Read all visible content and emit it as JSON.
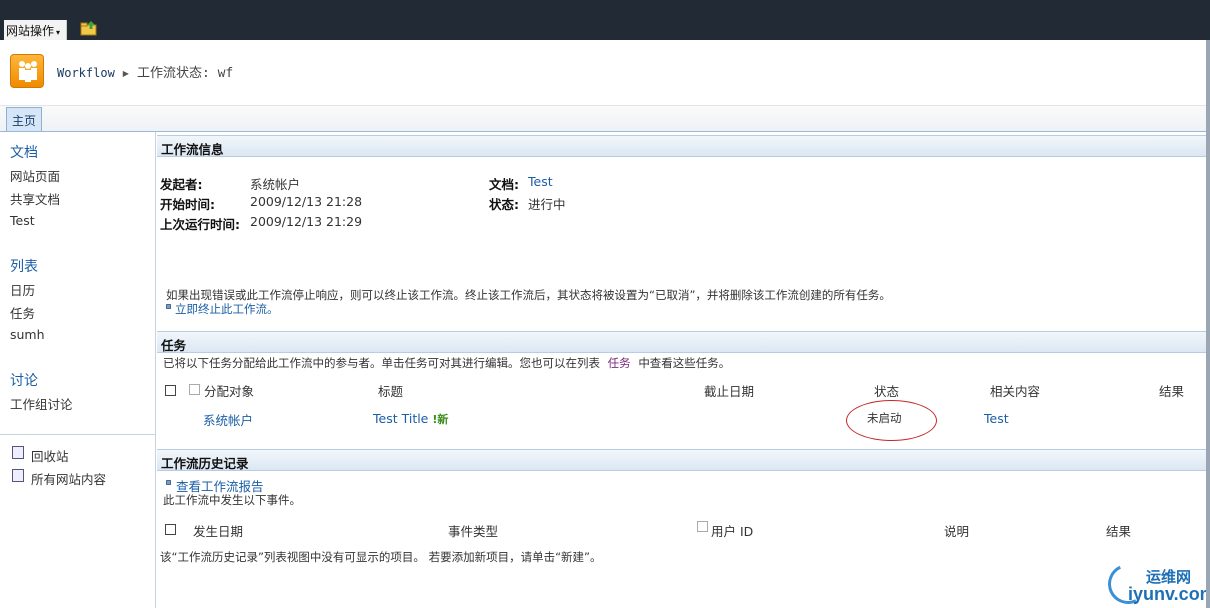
{
  "topbar": {
    "site_actions": "网站操作",
    "caret": "▾"
  },
  "header": {
    "site": "Workflow",
    "page_title": "工作流状态: wf"
  },
  "tabs": {
    "home": "主页"
  },
  "leftnav": {
    "docs_head": "文档",
    "docs": [
      "网站页面",
      "共享文档",
      "Test"
    ],
    "lists_head": "列表",
    "lists": [
      "日历",
      "任务",
      "sumh"
    ],
    "disc_head": "讨论",
    "disc": [
      "工作组讨论"
    ],
    "recycle": "回收站",
    "all_content": "所有网站内容"
  },
  "info": {
    "title": "工作流信息",
    "initiator_label": "发起者:",
    "initiator": "系统帐户",
    "start_label": "开始时间:",
    "start": "2009/12/13 21:28",
    "last_label": "上次运行时间:",
    "last": "2009/12/13 21:29",
    "doc_label": "文档:",
    "doc": "Test",
    "status_label": "状态:",
    "status": "进行中",
    "note": "如果出现错误或此工作流停止响应，则可以终止该工作流。终止该工作流后，其状态将被设置为“已取消”，并将删除该工作流创建的所有任务。",
    "terminate": "立即终止此工作流。"
  },
  "tasks": {
    "title": "任务",
    "desc_a": "已将以下任务分配给此工作流中的参与者。单击任务可对其进行编辑。您也可以在列表",
    "desc_link": "任务",
    "desc_b": "中查看这些任务。",
    "cols": {
      "assigned": "分配对象",
      "title": "标题",
      "due": "截止日期",
      "status": "状态",
      "related": "相关内容",
      "result": "结果"
    },
    "row": {
      "assigned": "系统帐户",
      "title": "Test Title",
      "new": "!新",
      "status": "未启动",
      "related": "Test"
    }
  },
  "history": {
    "title": "工作流历史记录",
    "report_link": "查看工作流报告",
    "desc": "此工作流中发生以下事件。",
    "cols": {
      "date": "发生日期",
      "event": "事件类型",
      "user": "用户 ID",
      "desc": "说明",
      "result": "结果"
    },
    "empty": "该“工作流历史记录”列表视图中没有可显示的项目。 若要添加新项目，请单击“新建”。"
  },
  "watermark": {
    "top": "运维网",
    "bottom": "iyunv.com"
  }
}
